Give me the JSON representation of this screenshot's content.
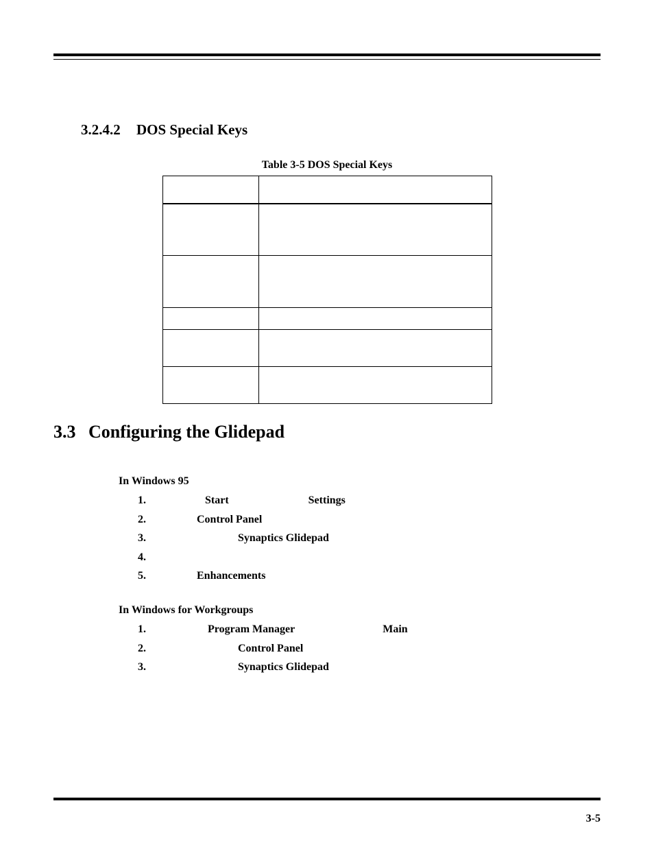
{
  "heading_sub": {
    "number": "3.2.4.2",
    "title": "DOS Special Keys"
  },
  "table_caption": "Table 3-5  DOS Special Keys",
  "heading_main": {
    "number": "3.3",
    "title": "Configuring the Glidepad"
  },
  "win95": {
    "lead": "In Windows 95",
    "steps": [
      {
        "num": "1",
        "a": "Start",
        "b": "Settings"
      },
      {
        "num": "2",
        "a": "Control Panel"
      },
      {
        "num": "3",
        "a": "Synaptics Glidepad"
      },
      {
        "num": "4"
      },
      {
        "num": "5",
        "a": "Enhancements"
      }
    ]
  },
  "wfw": {
    "lead": "In Windows for Workgroups",
    "steps": [
      {
        "num": "1",
        "a": "Program Manager",
        "b": "Main"
      },
      {
        "num": "2",
        "a": "Control Panel"
      },
      {
        "num": "3",
        "a": "Synaptics Glidepad"
      }
    ]
  },
  "page_number": "3-5"
}
